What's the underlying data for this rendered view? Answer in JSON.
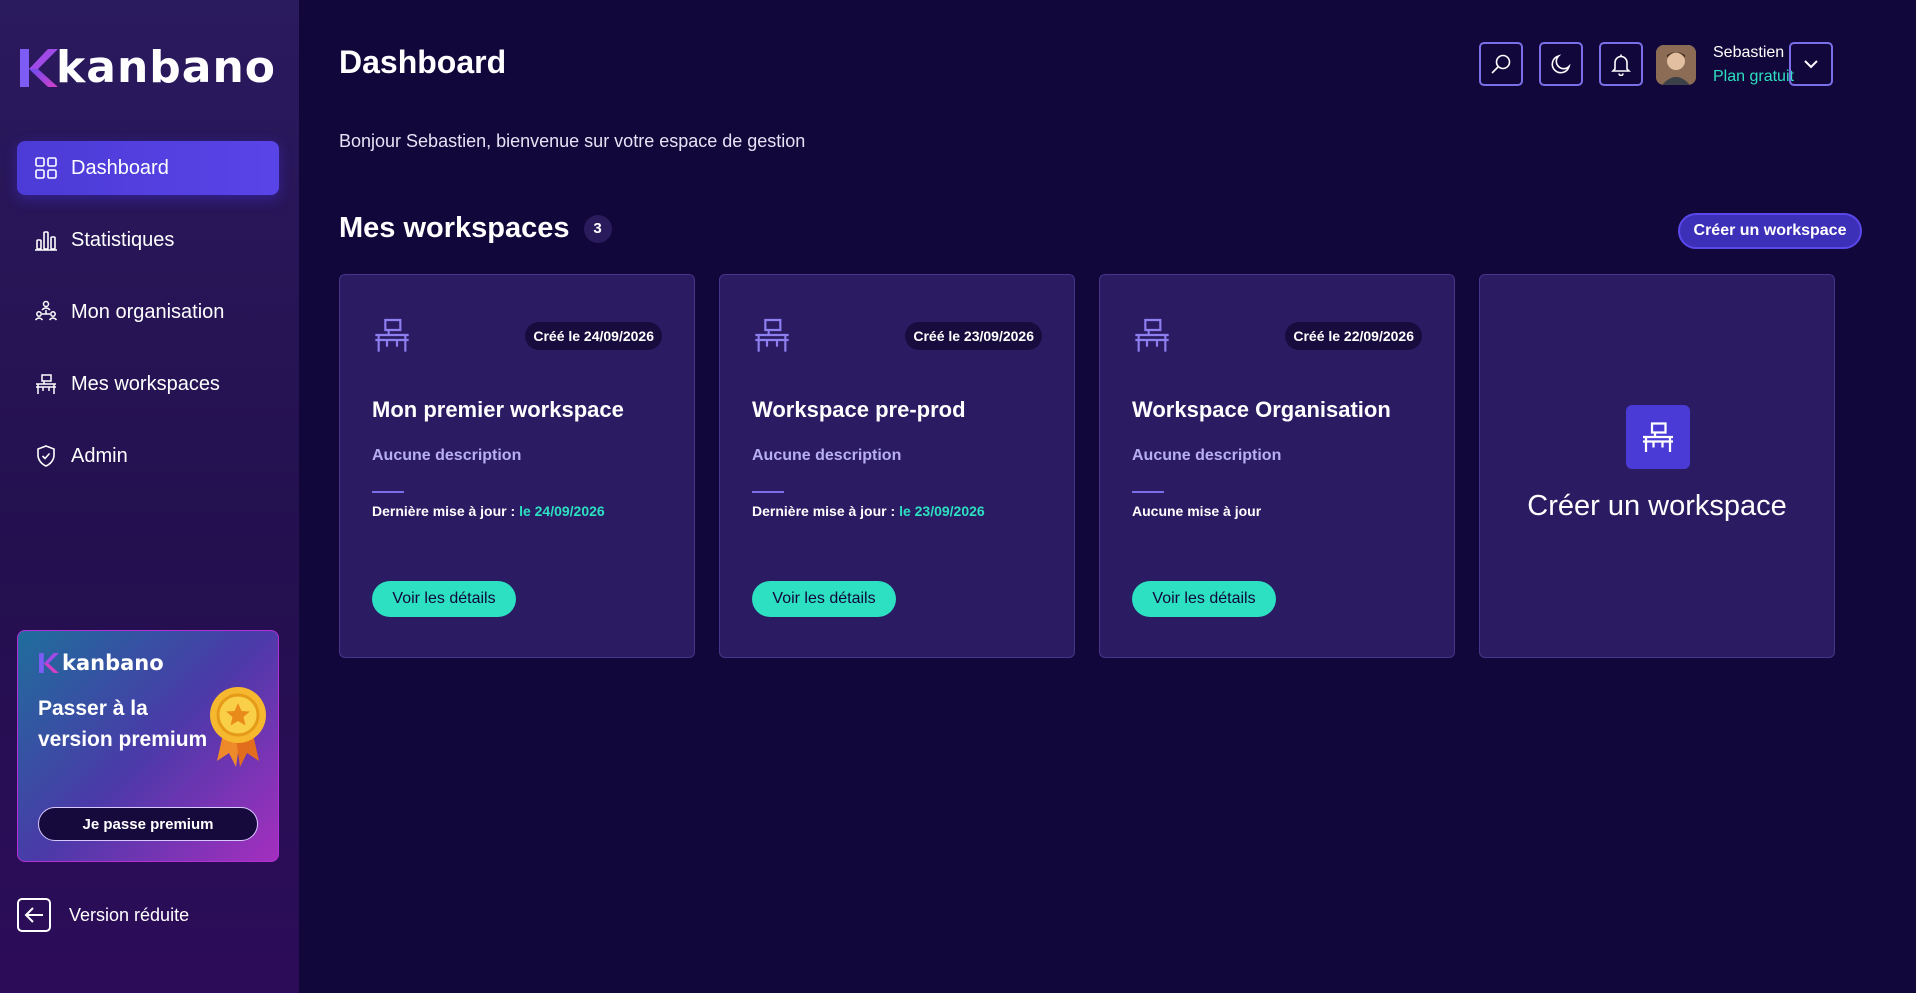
{
  "brand": {
    "name": "kanbano"
  },
  "sidebar": {
    "items": [
      {
        "label": "Dashboard",
        "icon": "grid-icon",
        "active": true
      },
      {
        "label": "Statistiques",
        "icon": "bar-chart-icon"
      },
      {
        "label": "Mon organisation",
        "icon": "organization-icon"
      },
      {
        "label": "Mes workspaces",
        "icon": "desk-icon"
      },
      {
        "label": "Admin",
        "icon": "shield-check-icon"
      }
    ],
    "promo": {
      "brand": "kanbano",
      "title": "Passer à la version premium",
      "button": "Je passe premium"
    },
    "collapse_label": "Version réduite"
  },
  "header": {
    "title": "Dashboard",
    "welcome": "Bonjour Sebastien, bienvenue sur votre espace de gestion",
    "user": {
      "name": "Sebastien",
      "plan": "Plan gratuit"
    }
  },
  "workspaces": {
    "title": "Mes workspaces",
    "count": "3",
    "create_button": "Créer un workspace",
    "cards": [
      {
        "created": "Créé le 24/09/2026",
        "name": "Mon premier workspace",
        "description": "Aucune description",
        "update_label": "Dernière mise à jour : ",
        "update_date": "le 24/09/2026",
        "button": "Voir les détails"
      },
      {
        "created": "Créé le 23/09/2026",
        "name": "Workspace pre-prod",
        "description": "Aucune description",
        "update_label": "Dernière mise à jour : ",
        "update_date": "le 23/09/2026",
        "button": "Voir les détails"
      },
      {
        "created": "Créé le 22/09/2026",
        "name": "Workspace Organisation",
        "description": "Aucune description",
        "update_label": "Aucune mise à jour",
        "update_date": "",
        "button": "Voir les détails"
      }
    ],
    "create_card_label": "Créer un workspace"
  },
  "colors": {
    "background": "#12073a",
    "accent": "#2de0c1",
    "primary": "#4c3bd6",
    "card": "#2b1b62"
  }
}
